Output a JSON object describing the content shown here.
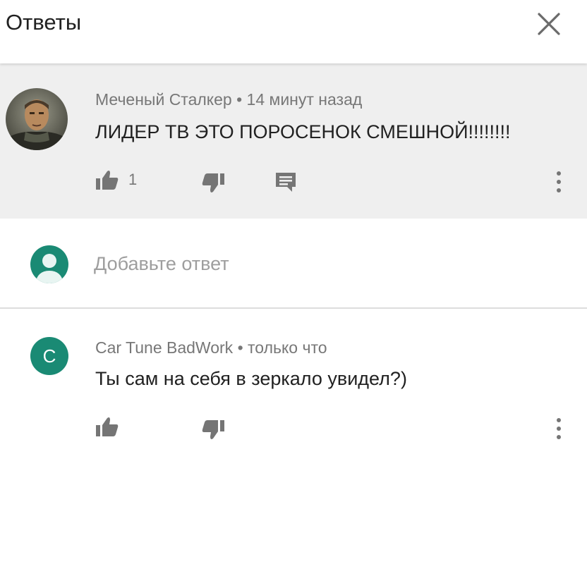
{
  "header": {
    "title": "Ответы",
    "close_icon": "close-icon"
  },
  "parent_comment": {
    "author": "Меченый Сталкер",
    "separator": "•",
    "time": "14 минут назад",
    "text": "ЛИДЕР ТВ ЭТО ПОРОСЕНОК СМЕШНОЙ!!!!!!!!",
    "like_count": "1",
    "icons": [
      "thumb-up-icon",
      "thumb-down-icon",
      "reply-icon",
      "more-vert-icon"
    ],
    "background": "#efefef"
  },
  "add_reply": {
    "placeholder": "Добавьте ответ",
    "avatar_color": "#1a8a74"
  },
  "reply_comment": {
    "avatar_letter": "C",
    "avatar_color": "#1a8a74",
    "author": "Car Tune BadWork",
    "separator": "•",
    "time": "только что",
    "text": "Ты сам на себя в зеркало увидел?)",
    "icons": [
      "thumb-up-icon",
      "thumb-down-icon",
      "more-vert-icon"
    ]
  }
}
